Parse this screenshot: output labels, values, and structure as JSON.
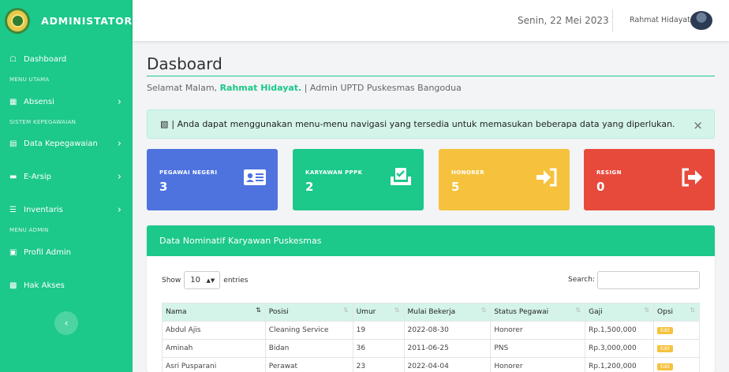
{
  "app": {
    "brand": "ADMINISTATOR"
  },
  "sidebar": {
    "items": [
      {
        "label": "Dashboard",
        "icon": "dashboard-icon"
      },
      {
        "heading": "MENU UTAMA"
      },
      {
        "label": "Absensi",
        "icon": "grid-icon"
      },
      {
        "heading": "SISTEM KEPEGAWAIAN"
      },
      {
        "label": "Data Kepegawaian",
        "icon": "people-icon"
      },
      {
        "label": "E-Arsip",
        "icon": "folder-icon"
      },
      {
        "label": "Inventaris",
        "icon": "list-icon"
      },
      {
        "heading": "MENU ADMIN"
      },
      {
        "label": "Profil Admin",
        "icon": "briefcase-icon"
      },
      {
        "label": "Hak Akses",
        "icon": "id-card-icon"
      }
    ],
    "toggle_glyph": "‹"
  },
  "topbar": {
    "date": "Senin, 22 Mei 2023",
    "user": "Rahmat Hidayat"
  },
  "page": {
    "title": "Dasboard",
    "greeting_prefix": "Selamat Malam,",
    "greeting_name": "Rahmat Hidayat.",
    "greeting_suffix": "| Admin UPTD Puskesmas Bangodua",
    "alert": "| Anda dapat menggunakan menu-menu navigasi yang tersedia untuk memasukan beberapa data yang diperlukan.",
    "alert_close": "×"
  },
  "cards": [
    {
      "title": "PEGAWAI NEGERI",
      "value": "3",
      "color": "#4e73df",
      "icon": "id-card-icon"
    },
    {
      "title": "KARYAWAN PPPK",
      "value": "2",
      "color": "#1cc88a",
      "icon": "check-inbox-icon"
    },
    {
      "title": "HONORER",
      "value": "5",
      "color": "#f6c23e",
      "icon": "sign-in-icon"
    },
    {
      "title": "RESIGN",
      "value": "0",
      "color": "#e74a3b",
      "icon": "sign-out-icon"
    }
  ],
  "table_panel": {
    "title": "Data Nominatif Karyawan Puskesmas",
    "show_label": "Show",
    "entries_value": "10",
    "entries_label": "entries",
    "search_label": "Search:",
    "columns": [
      "Nama",
      "Posisi",
      "Umur",
      "Mulai Bekerja",
      "Status Pegawai",
      "Gaji",
      "Opsi"
    ],
    "rows": [
      [
        "Abdul Ajis",
        "Cleaning Service",
        "19",
        "2022-08-30",
        "Honorer",
        "Rp.1,500,000",
        "Edit"
      ],
      [
        "Aminah",
        "Bidan",
        "36",
        "2011-06-25",
        "PNS",
        "Rp.3,000,000",
        "Edit"
      ],
      [
        "Asri Pusparani",
        "Perawat",
        "23",
        "2022-04-04",
        "Honorer",
        "Rp.1,200,000",
        "Edit"
      ]
    ]
  },
  "colors": {
    "primary": "#1cc88a",
    "alert_bg": "#d4f4ea"
  }
}
